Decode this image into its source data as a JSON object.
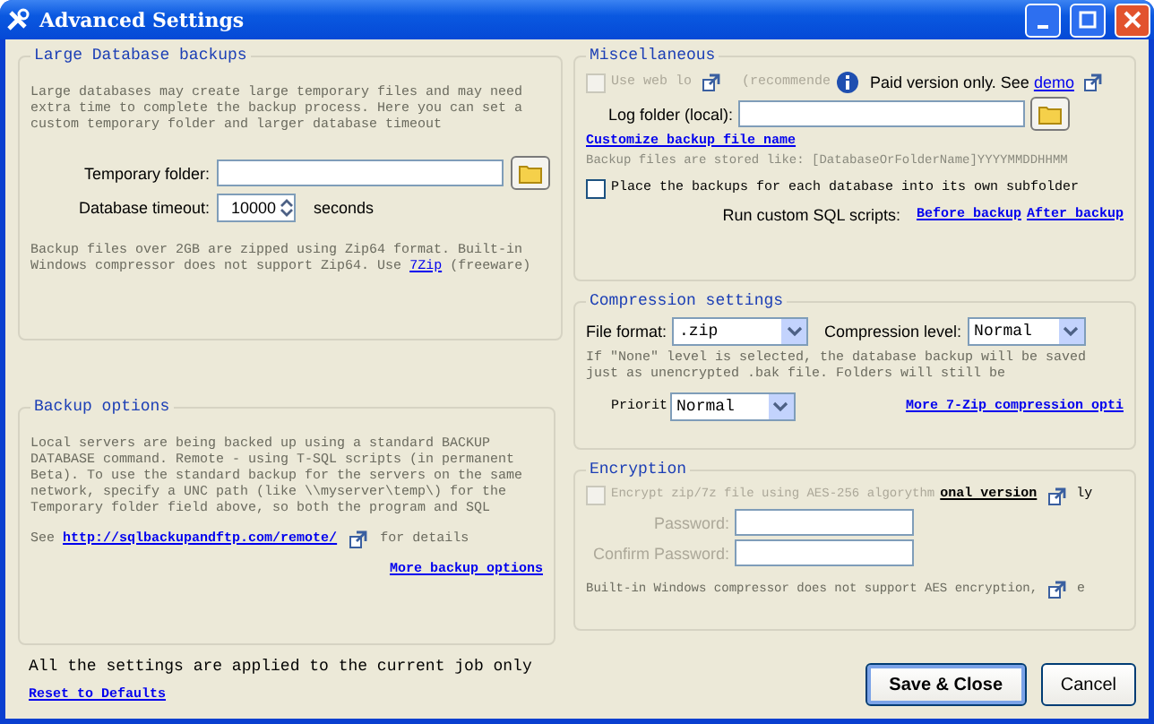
{
  "window": {
    "title": "Advanced Settings"
  },
  "large_db": {
    "title": "Large Database backups",
    "description": "Large databases may create large temporary files and may need extra time to complete the backup process. Here you can set a custom temporary folder and larger database timeout",
    "temp_folder_label": "Temporary folder:",
    "timeout_label": "Database timeout:",
    "timeout_value": "10000",
    "timeout_unit": "seconds",
    "note": "Backup files over 2GB are zipped using Zip64 format. Built-in Windows compressor does not support Zip64. Use",
    "note_link": "7Zip",
    "note_tail": "(freeware)"
  },
  "backup_options": {
    "title": "Backup options",
    "description": "Local servers are being backed up using a standard BACKUP DATABASE command. Remote - using T-SQL scripts (in permanent Beta). To use the standard backup for the servers on the same network, specify a UNC path  (like \\\\myserver\\temp\\) for the Temporary folder field above, so both the program and SQL",
    "see": "See",
    "link": "http://sqlbackupandftp.com/remote/",
    "see_tail": "for details",
    "more_link": "More backup options"
  },
  "footer": {
    "note": "All the settings are applied to the current job only",
    "reset_link": "Reset to Defaults"
  },
  "misc": {
    "title": "Miscellaneous",
    "web_log": {
      "label": "Use web lo",
      "checked": false,
      "disabled": true
    },
    "recommended": "(recommende",
    "paid_note": "Paid version only. See",
    "demo_link": "demo",
    "log_folder_label": "Log folder (local):",
    "customize_link": "Customize backup file name",
    "stored_like": "Backup files are stored like: [DatabaseOrFolderName]YYYYMMDDHHMM",
    "subfolder": {
      "label": "Place the backups for each database into its own subfolder",
      "checked": false
    },
    "scripts_label": "Run custom SQL scripts:",
    "before_link": "Before backup",
    "after_link": "After backup"
  },
  "compression": {
    "title": "Compression settings",
    "format_label": "File format:",
    "format_value": ".zip",
    "level_label": "Compression level:",
    "level_value": "Normal",
    "note": "If \"None\" level is selected, the database backup will be saved just as unencrypted .bak file. Folders will still be",
    "priority_label": "Priorit",
    "priority_value": "Normal",
    "more_link": "More 7-Zip compression opti"
  },
  "encryption": {
    "title": "Encryption",
    "encrypt": {
      "label": "Encrypt zip/7z file using AES-256 algorythm",
      "checked": false,
      "disabled": true
    },
    "pro_link": "onal version",
    "pro_tail": "ly",
    "password_label": "Password:",
    "confirm_label": "Confirm Password:",
    "note": "Built-in Windows compressor does not support AES encryption,",
    "note_tail": "e"
  },
  "buttons": [
    {
      "label": "Save & Close",
      "default": true
    },
    {
      "label": "Cancel",
      "default": false
    }
  ]
}
